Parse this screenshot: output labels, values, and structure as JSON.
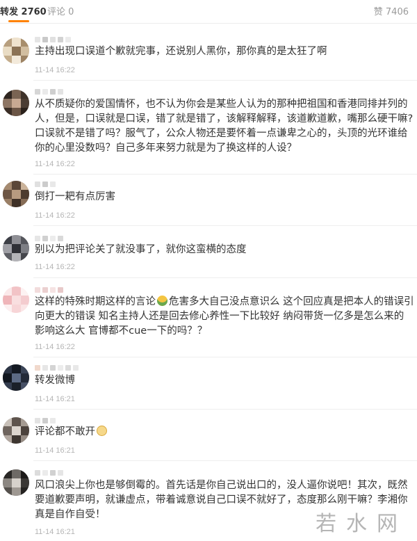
{
  "tabs": {
    "repost": "转发 2760",
    "comment": "评论 0",
    "like": "赞 7406"
  },
  "colors": {
    "accent": "#ff8200",
    "time": "#b5b5b5"
  },
  "comments": [
    {
      "text": "主持出现口误道个歉就完事，还说别人黑你，那你真的是太狂了啊",
      "time": "11-14 16:22"
    },
    {
      "text": "从不质疑你的爱国情怀，也不认为你会是某些人认为的那种把祖国和香港同排并列的人，但是，口误就是口误，错了就是错了，该解释解释，该道歉道歉，嘴那么硬干嘛?口误就不是错了吗？服气了，公众人物还是要怀着一点谦卑之心的，头顶的光环谁给你的心里没数吗？自己多年来努力就是为了换这样的人设？",
      "time": "11-14 16:22"
    },
    {
      "text": "倒打一耙有点厉害",
      "time": "11-14 16:22"
    },
    {
      "text": "别以为把评论关了就没事了，就你这蛮横的态度",
      "time": "11-14 16:22"
    },
    {
      "text_before": "这样的特殊时期这样的言论",
      "emoji": "melon-emoji",
      "text_after": "危害多大自己没点意识么 这个回应真是把本人的错误引向更大的错误 知名主持人还是回去修心养性一下比较好 纳闷带货一亿多是怎么来的 影响这么大 官博都不cue一下的吗？？",
      "time": "11-14 16:22"
    },
    {
      "text": "转发微博",
      "time": "11-14 16:21"
    },
    {
      "text": "评论都不敢开",
      "emoji": "doge-emoji",
      "time": "11-14 16:21"
    },
    {
      "text": "风口浪尖上你也是够倒霉的。首先话是你自己说出口的，没人逼你说吧！其次，既然要道歉要声明，就谦虚点，带着诚意说自己口误不就好了，态度那么刚干嘛？李湘你真是自作自受！",
      "time": "11-14 16:21"
    }
  ],
  "watermark": "若水网"
}
